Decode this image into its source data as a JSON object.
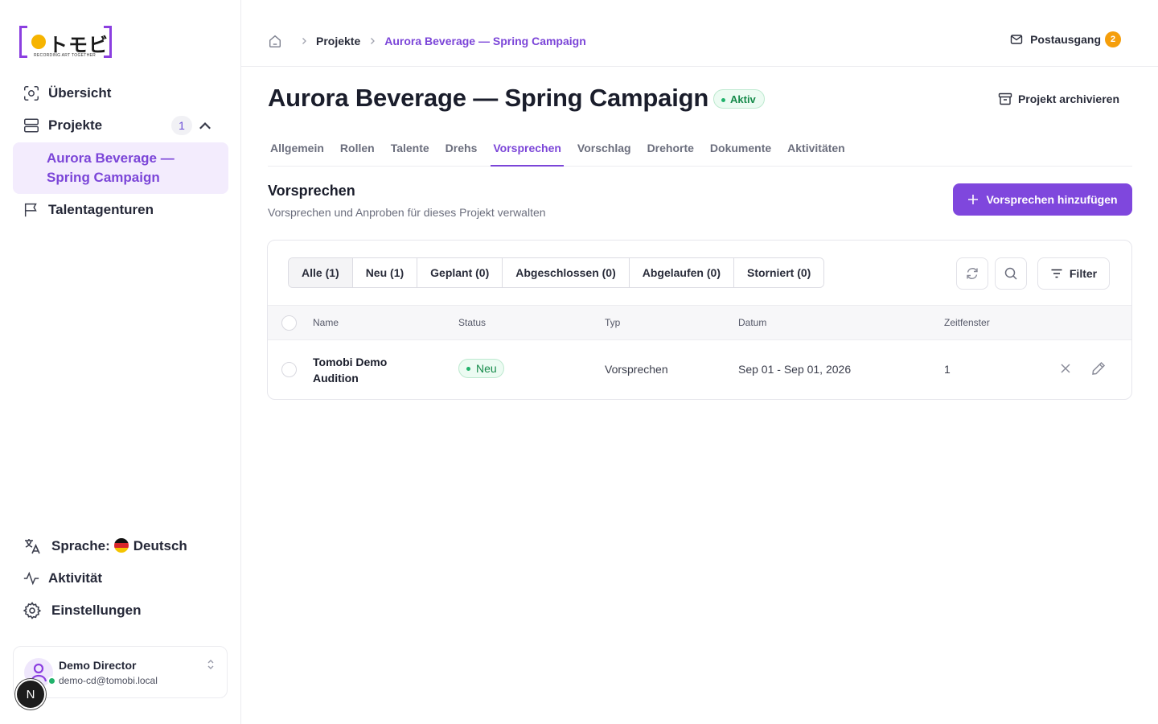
{
  "brand": {
    "logo_kana": "トモビ",
    "logo_tagline": "RECORDING ART TOGETHER",
    "accent": "#7b45d8",
    "logo_dot": "#f6b400"
  },
  "sidebar": {
    "items": [
      {
        "label": "Übersicht",
        "icon": "scan-icon"
      },
      {
        "label": "Projekte",
        "icon": "stack-icon",
        "badge": "1",
        "expanded": true
      },
      {
        "label": "Talentagenturen",
        "icon": "flag-icon"
      }
    ],
    "active_project": "Aurora Beverage — Spring Campaign",
    "bottom": {
      "language_label": "Sprache:",
      "language_value": "Deutsch",
      "activity": "Aktivität",
      "settings": "Einstellungen"
    },
    "user": {
      "name": "Demo Director",
      "email": "demo-cd@tomobi.local",
      "status_color": "#21b26b"
    },
    "n_bubble": "N"
  },
  "topbar": {
    "breadcrumbs": [
      "Projekte",
      "Aurora Beverage — Spring Campaign"
    ],
    "outbox_label": "Postausgang",
    "outbox_count": "2"
  },
  "project": {
    "title": "Aurora Beverage — Spring Campaign",
    "status": "Aktiv",
    "archive_label": "Projekt archivieren"
  },
  "tabs": [
    "Allgemein",
    "Rollen",
    "Talente",
    "Drehs",
    "Vorsprechen",
    "Vorschlag",
    "Drehorte",
    "Dokumente",
    "Aktivitäten"
  ],
  "active_tab": "Vorsprechen",
  "section": {
    "title": "Vorsprechen",
    "subtitle": "Vorsprechen und Anproben für dieses Projekt verwalten",
    "add_button": "Vorsprechen hinzufügen"
  },
  "filters": {
    "segments": [
      "Alle (1)",
      "Neu (1)",
      "Geplant (0)",
      "Abgeschlossen (0)",
      "Abgelaufen (0)",
      "Storniert (0)"
    ],
    "active_segment": "Alle (1)",
    "filter_label": "Filter"
  },
  "table": {
    "columns": [
      "Name",
      "Status",
      "Typ",
      "Datum",
      "Zeitfenster"
    ],
    "rows": [
      {
        "name": "Tomobi Demo Audition",
        "status": "Neu",
        "type": "Vorsprechen",
        "date": "Sep 01 - Sep 01, 2026",
        "slots": "1"
      }
    ]
  }
}
